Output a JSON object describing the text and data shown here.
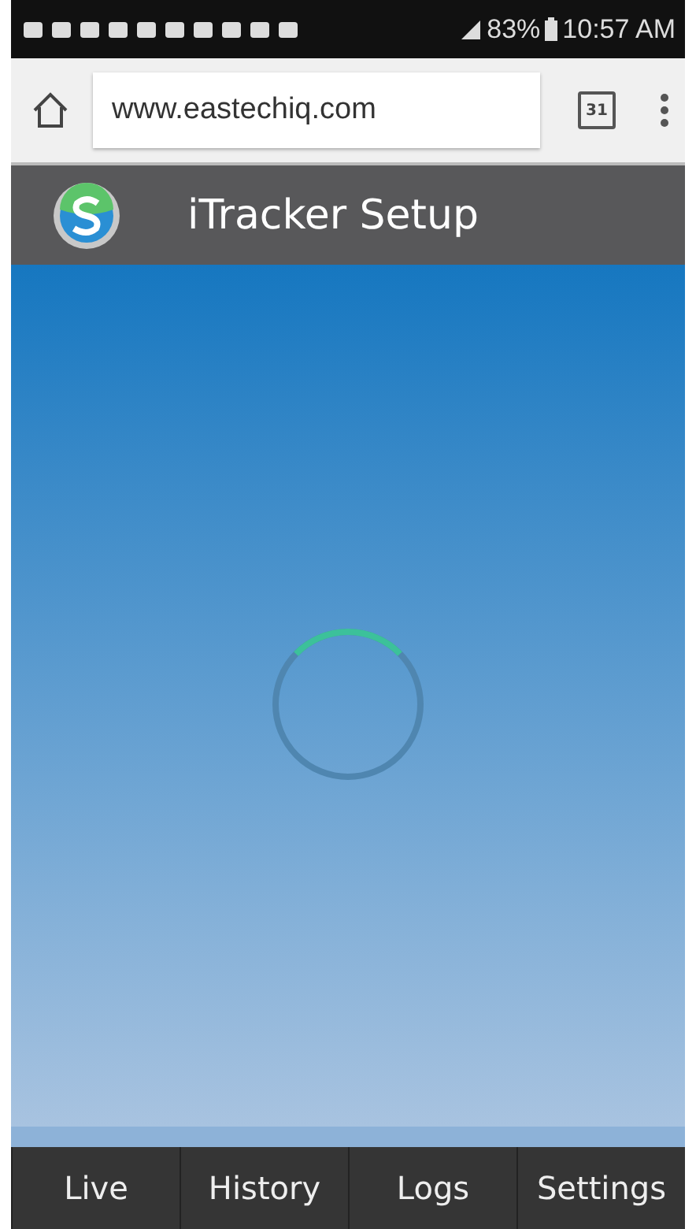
{
  "status_bar": {
    "battery": "83%",
    "time": "10:57 AM"
  },
  "browser": {
    "url": "www.eastechiq.com",
    "tab_count": "31"
  },
  "header": {
    "title": "iTracker Setup"
  },
  "tabs": [
    {
      "label": "Live"
    },
    {
      "label": "History"
    },
    {
      "label": "Logs"
    },
    {
      "label": "Settings"
    }
  ]
}
